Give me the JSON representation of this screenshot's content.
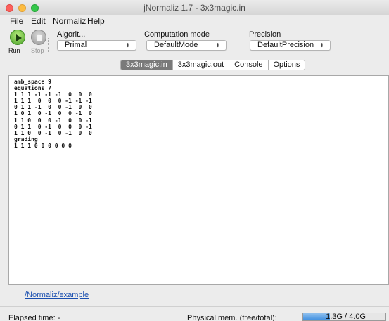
{
  "window": {
    "title": "jNormaliz 1.7 - 3x3magic.in"
  },
  "menu": [
    "File",
    "Edit",
    "Normaliz",
    "Help"
  ],
  "toolbar": {
    "run_label": "Run",
    "stop_label": "Stop",
    "algorithm": {
      "label": "Algorit...",
      "value": "Primal"
    },
    "mode": {
      "label": "Computation mode",
      "value": "DefaultMode"
    },
    "precision": {
      "label": "Precision",
      "value": "DefaultPrecision"
    }
  },
  "tabs": [
    {
      "label": "3x3magic.in",
      "active": true
    },
    {
      "label": "3x3magic.out",
      "active": false
    },
    {
      "label": "Console",
      "active": false
    },
    {
      "label": "Options",
      "active": false
    }
  ],
  "editor": {
    "lines": [
      "amb_space 9",
      "equations 7",
      "1 1 1 -1 -1 -1  0  0  0",
      "1 1 1  0  0  0 -1 -1 -1",
      "0 1 1 -1  0  0 -1  0  0",
      "1 0 1  0 -1  0  0 -1  0",
      "1 1 0  0  0 -1  0  0 -1",
      "0 1 1  0 -1  0  0  0 -1",
      "1 1 0  0 -1  0 -1  0  0",
      "grading",
      "1 1 1 0 0 0 0 0 0"
    ]
  },
  "path_link": "/Normaliz/example",
  "status": {
    "elapsed": "Elapsed time: -",
    "physmem_label": "Physical mem. (free/total):",
    "mem_text": "1.3G / 4.0G",
    "mem_fraction": 0.325
  },
  "colors": {
    "run": "#4ba12a",
    "link": "#1a4fb0",
    "active_tab": "#7a7a7a",
    "mem_bar": "#3f8fe0"
  }
}
